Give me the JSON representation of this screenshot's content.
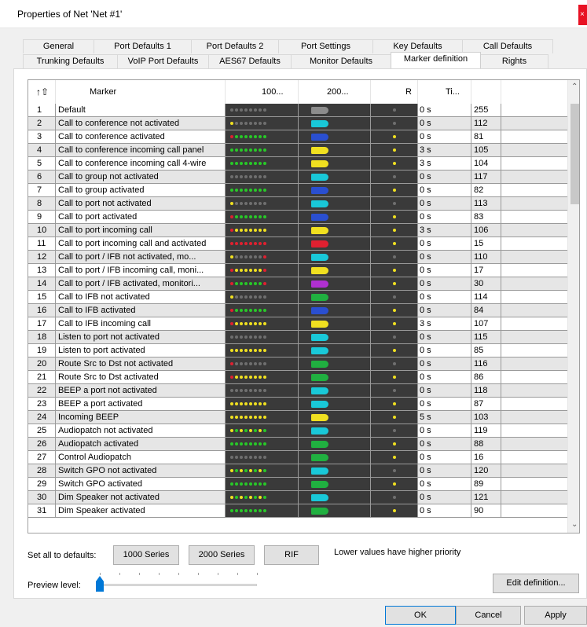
{
  "window": {
    "title": "Properties of Net 'Net #1'",
    "close_glyph": "×"
  },
  "tabs_row1": [
    "General",
    "Port Defaults 1",
    "Port Defaults 2",
    "Port Settings",
    "Key Defaults",
    "Call Defaults"
  ],
  "tabs_row2": [
    "Trunking Defaults",
    "VoIP Port Defaults",
    "AES67 Defaults",
    "Monitor Defaults",
    "Marker definition",
    "Rights"
  ],
  "active_tab": "Marker definition",
  "grid": {
    "sort_icon": "↑⇧",
    "columns": {
      "marker": "Marker",
      "c1000": "100...",
      "c2000": "200...",
      "r": "R",
      "ti": "Ti..."
    },
    "rows": [
      {
        "n": "1",
        "name": "Default",
        "ti": "0 s",
        "val": "255",
        "dots": "g8",
        "blob": "#8c8c8c",
        "r": "g"
      },
      {
        "n": "2",
        "name": "Call to conference not activated",
        "ti": "0 s",
        "val": "112",
        "dots": "y1g7",
        "blob": "#19c8d8",
        "r": "g"
      },
      {
        "n": "3",
        "name": "Call to conference activated",
        "ti": "0 s",
        "val": "81",
        "dots": "r1G7",
        "blob": "#2a4fd0",
        "r": "y"
      },
      {
        "n": "4",
        "name": "Call to conference incoming call panel",
        "ti": "3 s",
        "val": "105",
        "dots": "G8",
        "blob": "#f0e020",
        "r": "y"
      },
      {
        "n": "5",
        "name": "Call to conference incoming call 4-wire",
        "ti": "3 s",
        "val": "104",
        "dots": "G8",
        "blob": "#f0e020",
        "r": "y"
      },
      {
        "n": "6",
        "name": "Call to group not activated",
        "ti": "0 s",
        "val": "117",
        "dots": "g8",
        "blob": "#19c8d8",
        "r": "g"
      },
      {
        "n": "7",
        "name": "Call to group activated",
        "ti": "0 s",
        "val": "82",
        "dots": "G8",
        "blob": "#2a4fd0",
        "r": "y"
      },
      {
        "n": "8",
        "name": "Call to port not activated",
        "ti": "0 s",
        "val": "113",
        "dots": "y1g7",
        "blob": "#19c8d8",
        "r": "g"
      },
      {
        "n": "9",
        "name": "Call to port activated",
        "ti": "0 s",
        "val": "83",
        "dots": "r1G7",
        "blob": "#2a4fd0",
        "r": "y"
      },
      {
        "n": "10",
        "name": "Call to port incoming call",
        "ti": "3 s",
        "val": "106",
        "dots": "r1Y7",
        "blob": "#f0e020",
        "r": "y"
      },
      {
        "n": "11",
        "name": "Call to port incoming call and activated",
        "ti": "0 s",
        "val": "15",
        "dots": "R8",
        "blob": "#e02030",
        "r": "y"
      },
      {
        "n": "12",
        "name": "Call to port / IFB not activated, mo...",
        "ti": "0 s",
        "val": "110",
        "dots": "y1g6r1",
        "blob": "#19c8d8",
        "r": "g"
      },
      {
        "n": "13",
        "name": "Call to port / IFB incoming call, moni...",
        "ti": "0 s",
        "val": "17",
        "dots": "r1Y6r1",
        "blob": "#f0e020",
        "r": "y"
      },
      {
        "n": "14",
        "name": "Call to port / IFB activated, monitori...",
        "ti": "0 s",
        "val": "30",
        "dots": "r1G6r1",
        "blob": "#b030d0",
        "r": "y"
      },
      {
        "n": "15",
        "name": "Call to IFB not activated",
        "ti": "0 s",
        "val": "114",
        "dots": "y1g7",
        "blob": "#20b040",
        "r": "g"
      },
      {
        "n": "16",
        "name": "Call to IFB activated",
        "ti": "0 s",
        "val": "84",
        "dots": "r1G7",
        "blob": "#2a4fd0",
        "r": "y"
      },
      {
        "n": "17",
        "name": "Call to IFB incoming call",
        "ti": "3 s",
        "val": "107",
        "dots": "r1Y7",
        "blob": "#f0e020",
        "r": "y"
      },
      {
        "n": "18",
        "name": "Listen to port not activated",
        "ti": "0 s",
        "val": "115",
        "dots": "g8",
        "blob": "#19c8d8",
        "r": "g"
      },
      {
        "n": "19",
        "name": "Listen to port activated",
        "ti": "0 s",
        "val": "85",
        "dots": "Y8",
        "blob": "#19c8d8",
        "r": "y"
      },
      {
        "n": "20",
        "name": "Route Src to Dst not activated",
        "ti": "0 s",
        "val": "116",
        "dots": "r1g7",
        "blob": "#20b040",
        "r": "g"
      },
      {
        "n": "21",
        "name": "Route Src to Dst activated",
        "ti": "0 s",
        "val": "86",
        "dots": "r1Y7",
        "blob": "#20b040",
        "r": "y"
      },
      {
        "n": "22",
        "name": "BEEP a port not activated",
        "ti": "0 s",
        "val": "118",
        "dots": "g8",
        "blob": "#19c8d8",
        "r": "g"
      },
      {
        "n": "23",
        "name": "BEEP a port activated",
        "ti": "0 s",
        "val": "87",
        "dots": "Y8",
        "blob": "#19c8d8",
        "r": "y"
      },
      {
        "n": "24",
        "name": "Incoming BEEP",
        "ti": "5 s",
        "val": "103",
        "dots": "Y8",
        "blob": "#f0e020",
        "r": "y"
      },
      {
        "n": "25",
        "name": "Audiopatch not activated",
        "ti": "0 s",
        "val": "119",
        "dots": "yG",
        "blob": "#19c8d8",
        "r": "g"
      },
      {
        "n": "26",
        "name": "Audiopatch activated",
        "ti": "0 s",
        "val": "88",
        "dots": "G8",
        "blob": "#20b040",
        "r": "y"
      },
      {
        "n": "27",
        "name": "Control Audiopatch",
        "ti": "0 s",
        "val": "16",
        "dots": "g8",
        "blob": "#20b040",
        "r": "y"
      },
      {
        "n": "28",
        "name": "Switch GPO not activated",
        "ti": "0 s",
        "val": "120",
        "dots": "yG",
        "blob": "#19c8d8",
        "r": "g"
      },
      {
        "n": "29",
        "name": "Switch GPO  activated",
        "ti": "0 s",
        "val": "89",
        "dots": "G8",
        "blob": "#20b040",
        "r": "y"
      },
      {
        "n": "30",
        "name": "Dim Speaker not activated",
        "ti": "0 s",
        "val": "121",
        "dots": "yG",
        "blob": "#19c8d8",
        "r": "g"
      },
      {
        "n": "31",
        "name": "Dim Speaker activated",
        "ti": "0 s",
        "val": "90",
        "dots": "G8",
        "blob": "#20b040",
        "r": "y"
      }
    ]
  },
  "defaults": {
    "label": "Set all to defaults:",
    "btn_1000": "1000 Series",
    "btn_2000": "2000 Series",
    "btn_rif": "RIF",
    "note": "Lower values have higher priority"
  },
  "preview": {
    "label": "Preview level:",
    "level_fraction": 0
  },
  "edit_button": "Edit definition...",
  "footer": {
    "ok": "OK",
    "cancel": "Cancel",
    "apply": "Apply"
  },
  "colors": {
    "dot_off": "#6f6f6f",
    "dot_green": "#28c828",
    "dot_yellow": "#f0e020",
    "dot_red": "#e02030",
    "row_alt": "#e6e6e6",
    "slider": "#0078d7",
    "close": "#e81123"
  }
}
